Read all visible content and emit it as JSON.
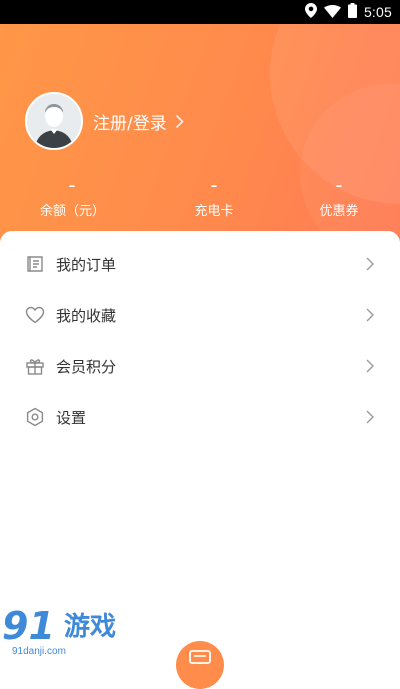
{
  "status_bar": {
    "time": "5:05"
  },
  "profile": {
    "login_label": "注册/登录"
  },
  "stats": [
    {
      "value": "–",
      "label": "余额（元）"
    },
    {
      "value": "–",
      "label": "充电卡"
    },
    {
      "value": "–",
      "label": "优惠券"
    }
  ],
  "menu": [
    {
      "label": "我的订单",
      "icon": "orders-icon"
    },
    {
      "label": "我的收藏",
      "icon": "heart-icon"
    },
    {
      "label": "会员积分",
      "icon": "gift-icon"
    },
    {
      "label": "设置",
      "icon": "settings-icon"
    }
  ],
  "watermark": {
    "brand_number": "91",
    "brand_name": "游戏",
    "url": "91danji.com"
  },
  "colors": {
    "header_start": "#ff9747",
    "header_end": "#ff7a54",
    "accent": "#ff8c4a",
    "menu_text": "#333333",
    "watermark": "#3f8ad8"
  }
}
